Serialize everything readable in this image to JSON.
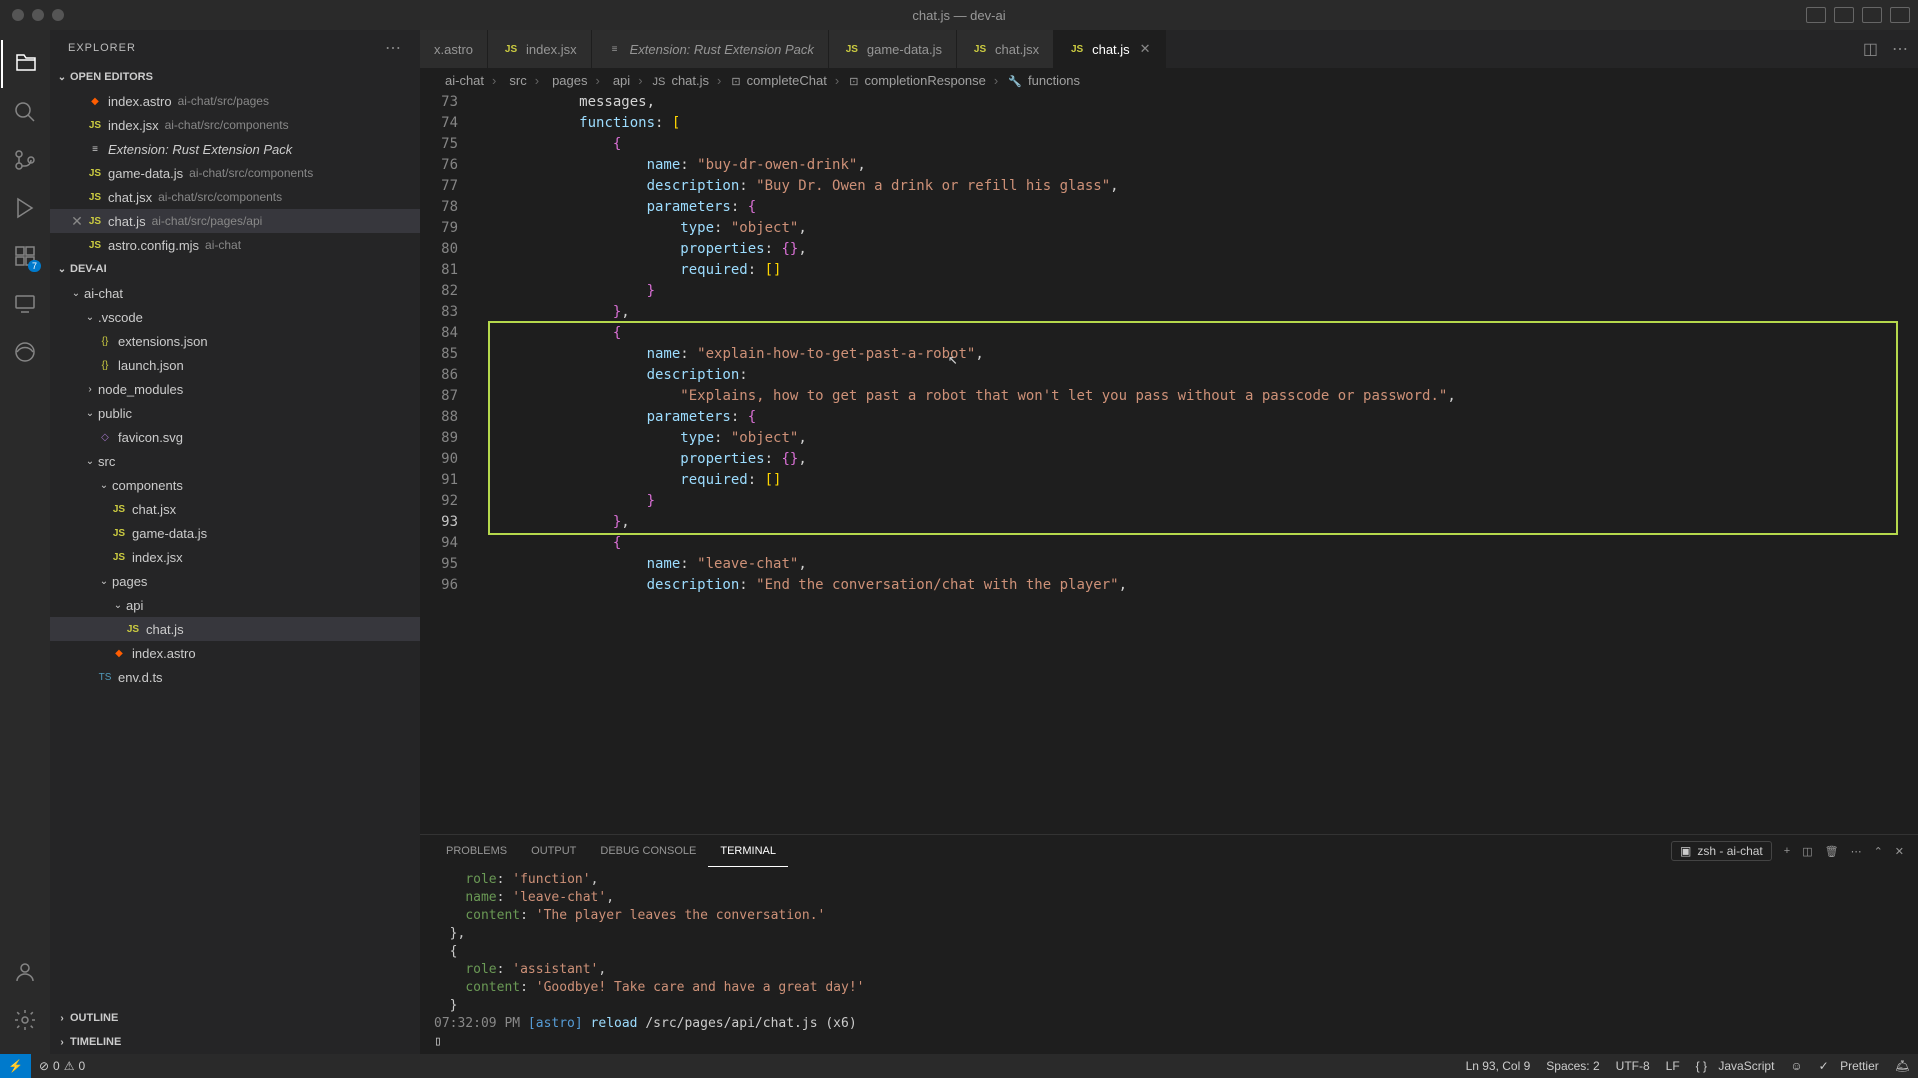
{
  "window": {
    "title": "chat.js — dev-ai"
  },
  "sidebar": {
    "title": "EXPLORER",
    "sections": {
      "openEditors": "OPEN EDITORS",
      "project": "DEV-AI",
      "outline": "OUTLINE",
      "timeline": "TIMELINE"
    },
    "editors": [
      {
        "icon": "astro",
        "name": "index.astro",
        "path": "ai-chat/src/pages"
      },
      {
        "icon": "js",
        "name": "index.jsx",
        "path": "ai-chat/src/components"
      },
      {
        "icon": "ext",
        "name": "Extension: Rust Extension Pack",
        "path": "",
        "italic": true
      },
      {
        "icon": "js",
        "name": "game-data.js",
        "path": "ai-chat/src/components"
      },
      {
        "icon": "js",
        "name": "chat.jsx",
        "path": "ai-chat/src/components"
      },
      {
        "icon": "js",
        "name": "chat.js",
        "path": "ai-chat/src/pages/api",
        "active": true
      },
      {
        "icon": "js",
        "name": "astro.config.mjs",
        "path": "ai-chat"
      }
    ],
    "tree": [
      {
        "depth": 0,
        "type": "folder",
        "open": true,
        "name": "ai-chat"
      },
      {
        "depth": 1,
        "type": "folder",
        "open": true,
        "name": ".vscode"
      },
      {
        "depth": 2,
        "type": "file",
        "icon": "json",
        "name": "extensions.json"
      },
      {
        "depth": 2,
        "type": "file",
        "icon": "json",
        "name": "launch.json"
      },
      {
        "depth": 1,
        "type": "folder",
        "open": false,
        "name": "node_modules"
      },
      {
        "depth": 1,
        "type": "folder",
        "open": true,
        "name": "public"
      },
      {
        "depth": 2,
        "type": "file",
        "icon": "svg",
        "name": "favicon.svg"
      },
      {
        "depth": 1,
        "type": "folder",
        "open": true,
        "name": "src"
      },
      {
        "depth": 2,
        "type": "folder",
        "open": true,
        "name": "components"
      },
      {
        "depth": 3,
        "type": "file",
        "icon": "js",
        "name": "chat.jsx"
      },
      {
        "depth": 3,
        "type": "file",
        "icon": "js",
        "name": "game-data.js"
      },
      {
        "depth": 3,
        "type": "file",
        "icon": "js",
        "name": "index.jsx"
      },
      {
        "depth": 2,
        "type": "folder",
        "open": true,
        "name": "pages"
      },
      {
        "depth": 3,
        "type": "folder",
        "open": true,
        "name": "api"
      },
      {
        "depth": 4,
        "type": "file",
        "icon": "js",
        "name": "chat.js",
        "active": true
      },
      {
        "depth": 3,
        "type": "file",
        "icon": "astro",
        "name": "index.astro"
      },
      {
        "depth": 2,
        "type": "file",
        "icon": "ts",
        "name": "env.d.ts"
      }
    ]
  },
  "scmBadge": "7",
  "tabs": [
    {
      "label": "x.astro",
      "icon": ""
    },
    {
      "label": "index.jsx",
      "icon": "JS"
    },
    {
      "label": "Extension: Rust Extension Pack",
      "icon": "≡",
      "italic": true
    },
    {
      "label": "game-data.js",
      "icon": "JS"
    },
    {
      "label": "chat.jsx",
      "icon": "JS"
    },
    {
      "label": "chat.js",
      "icon": "JS",
      "active": true
    }
  ],
  "breadcrumb": [
    "ai-chat",
    "src",
    "pages",
    "api",
    "chat.js",
    "completeChat",
    "completionResponse",
    "functions"
  ],
  "code": {
    "startLine": 73,
    "activeLine": 93,
    "lines": [
      "            messages,",
      "            functions: [",
      "                {",
      "                    name: \"buy-dr-owen-drink\",",
      "                    description: \"Buy Dr. Owen a drink or refill his glass\",",
      "                    parameters: {",
      "                        type: \"object\",",
      "                        properties: {},",
      "                        required: []",
      "                    }",
      "                },",
      "                {",
      "                    name: \"explain-how-to-get-past-a-robot\",",
      "                    description:",
      "                        \"Explains, how to get past a robot that won't let you pass without a passcode or password.\",",
      "                    parameters: {",
      "                        type: \"object\",",
      "                        properties: {},",
      "                        required: []",
      "                    }",
      "                },",
      "                {",
      "                    name: \"leave-chat\",",
      "                    description: \"End the conversation/chat with the player\","
    ]
  },
  "panel": {
    "tabs": [
      "PROBLEMS",
      "OUTPUT",
      "DEBUG CONSOLE",
      "TERMINAL"
    ],
    "activeTab": "TERMINAL",
    "terminalName": "zsh - ai-chat",
    "terminalLines": [
      "    role: 'function',",
      "    name: 'leave-chat',",
      "    content: 'The player leaves the conversation.'",
      "  },",
      "  {",
      "    role: 'assistant',",
      "    content: 'Goodbye! Take care and have a great day!'",
      "  }",
      "07:32:09 PM [astro] reload /src/pages/api/chat.js (x6)",
      "▯"
    ]
  },
  "status": {
    "errors": "0",
    "warnings": "0",
    "cursor": "Ln 93, Col 9",
    "spaces": "Spaces: 2",
    "encoding": "UTF-8",
    "eol": "LF",
    "lang": "JavaScript",
    "prettier": "Prettier"
  }
}
